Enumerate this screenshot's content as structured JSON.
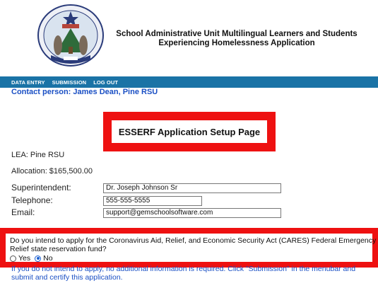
{
  "header": {
    "title_line1": "School Administrative Unit Multilingual Learners and Students",
    "title_line2": "Experiencing Homelessness Application",
    "seal_icon": "maine-state-seal-icon"
  },
  "menubar": {
    "items": [
      "DATA ENTRY",
      "SUBMISSION",
      "LOG OUT"
    ],
    "background": "#1a73a6"
  },
  "contact": "Contact person: James Dean, Pine RSU",
  "setup": {
    "title": "ESSERF Application Setup Page",
    "border_color": "#ee1111"
  },
  "lea": "LEA: Pine RSU",
  "allocation": "Allocation: $165,500.00",
  "fields": {
    "superintendent": {
      "label": "Superintendent:",
      "value": "Dr. Joseph Johnson Sr"
    },
    "telephone": {
      "label": "Telephone:",
      "value": "555-555-5555"
    },
    "email": {
      "label": "Email:",
      "value": "support@gemschoolsoftware.com"
    }
  },
  "question": {
    "text": "Do you intend to apply for the Coronavirus Aid, Relief, and Economic Security Act (CARES) Federal Emergency Relief state reservation fund?",
    "options": [
      "Yes",
      "No"
    ],
    "selected": "No"
  },
  "note": "If you do not intend to apply, no additional information is required. Click \"Submission\" in the menubar and submit and certify this application."
}
